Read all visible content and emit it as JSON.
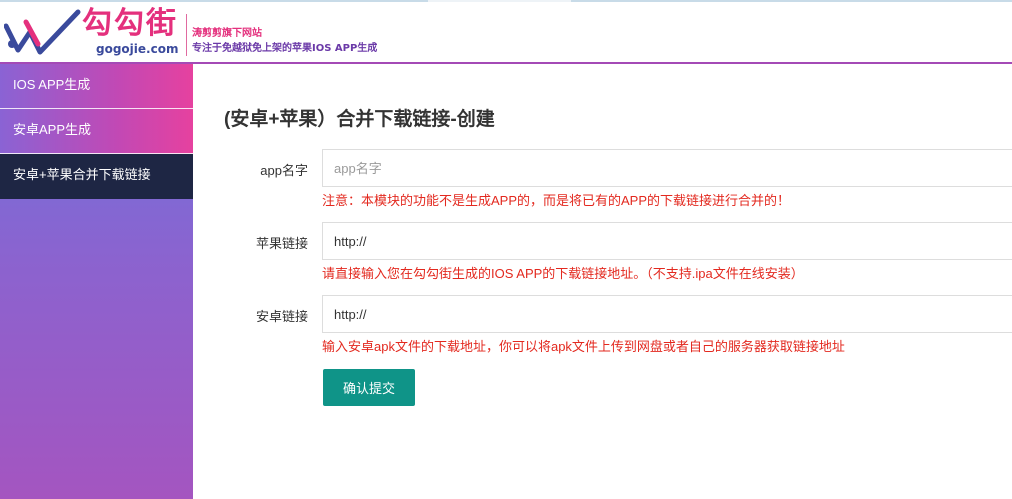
{
  "header": {
    "logo_text": "勾勾街",
    "logo_domain": "gogojie.com",
    "tagline_line1": "涛剪剪旗下网站",
    "tagline_line2": "专注于免越狱免上架的苹果IOS APP生成",
    "logo_mark_icon": "check-swoosh-logo",
    "colors": {
      "brand_pink": "#e4307d",
      "brand_blue": "#3a4a9c",
      "brand_purple": "#6b3aa8"
    }
  },
  "sidebar": {
    "items": [
      {
        "label": "IOS APP生成",
        "active": false
      },
      {
        "label": "安卓APP生成",
        "active": false
      },
      {
        "label": "安卓+苹果合并下载链接",
        "active": true
      }
    ]
  },
  "main": {
    "title": "(安卓+苹果）合并下载链接-创建",
    "form": {
      "app_name": {
        "label": "app名字",
        "value": "",
        "placeholder": "app名字",
        "hint": "注意：本模块的功能不是生成APP的，而是将已有的APP的下载链接进行合并的！"
      },
      "apple_link": {
        "label": "苹果链接",
        "value": "http://",
        "hint": "请直接输入您在勾勾街生成的IOS APP的下载链接地址。（不支持.ipa文件在线安装）"
      },
      "android_link": {
        "label": "安卓链接",
        "value": "http://",
        "hint": "输入安卓apk文件的下载地址，你可以将apk文件上传到网盘或者自己的服务器获取链接地址"
      },
      "submit_label": "确认提交"
    },
    "colors": {
      "hint_red": "#e3291f",
      "button_teal": "#0f9488"
    }
  }
}
